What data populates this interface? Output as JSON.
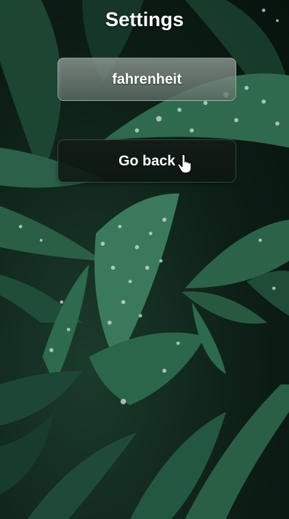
{
  "screen": {
    "title": "Settings"
  },
  "buttons": {
    "unit_label": "fahrenheit",
    "back_label": "Go back"
  },
  "colors": {
    "title_text": "#ffffff",
    "button_text": "#ffffff",
    "unit_button_bg": "#8a968f",
    "back_button_bg": "#141c18"
  },
  "icons": {
    "cursor": "hand-pointer-icon"
  }
}
